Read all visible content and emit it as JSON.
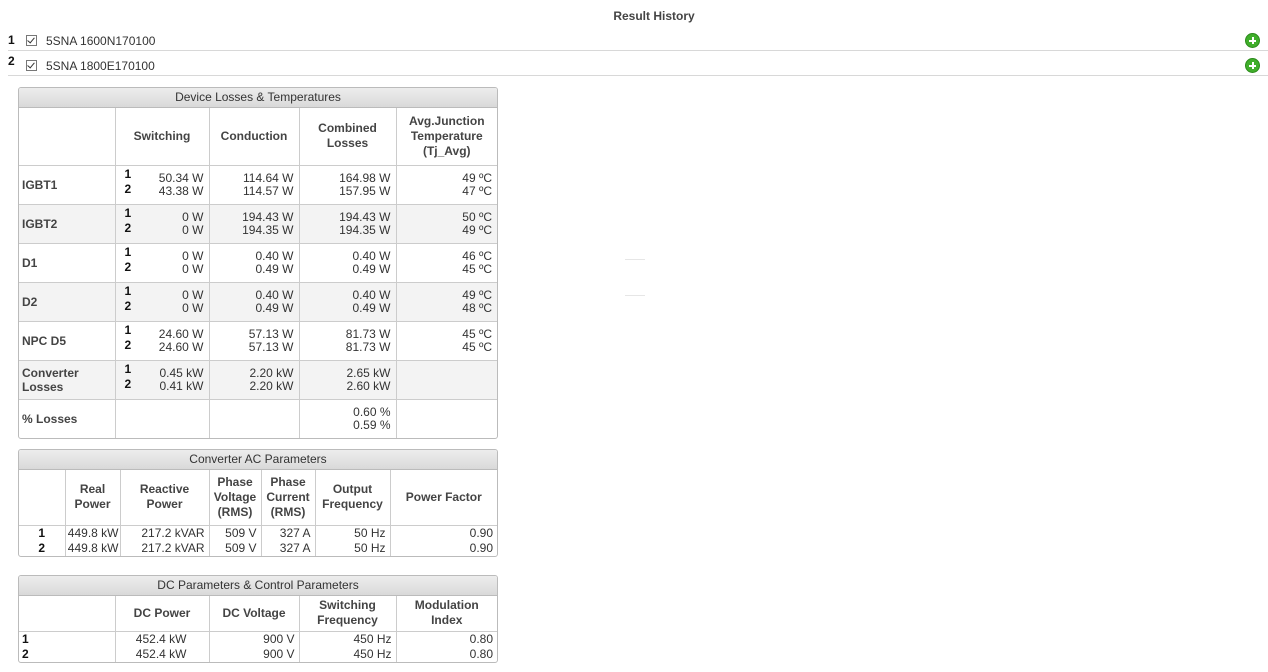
{
  "history": {
    "title": "Result History",
    "items": [
      {
        "index": "1",
        "name": "5SNA 1600N170100"
      },
      {
        "index": "2",
        "name": "5SNA 1800E170100"
      }
    ]
  },
  "losses": {
    "title": "Device Losses & Temperatures",
    "headers": [
      "Switching",
      "Conduction",
      "Combined Losses",
      "Avg.Junction Temperature (Tj_Avg)"
    ],
    "series_labels": [
      "1",
      "2"
    ],
    "rows": [
      {
        "label": "IGBT1",
        "switching": [
          "50.34 W",
          "43.38 W"
        ],
        "conduction": [
          "114.64 W",
          "114.57 W"
        ],
        "combined": [
          "164.98 W",
          "157.95 W"
        ],
        "temp": [
          "49 ºC",
          "47 ºC"
        ]
      },
      {
        "label": "IGBT2",
        "switching": [
          "0 W",
          "0 W"
        ],
        "conduction": [
          "194.43 W",
          "194.35 W"
        ],
        "combined": [
          "194.43 W",
          "194.35 W"
        ],
        "temp": [
          "50 ºC",
          "49 ºC"
        ]
      },
      {
        "label": "D1",
        "switching": [
          "0 W",
          "0 W"
        ],
        "conduction": [
          "0.40 W",
          "0.49 W"
        ],
        "combined": [
          "0.40 W",
          "0.49 W"
        ],
        "temp": [
          "46 ºC",
          "45 ºC"
        ]
      },
      {
        "label": "D2",
        "switching": [
          "0 W",
          "0 W"
        ],
        "conduction": [
          "0.40 W",
          "0.49 W"
        ],
        "combined": [
          "0.40 W",
          "0.49 W"
        ],
        "temp": [
          "49 ºC",
          "48 ºC"
        ]
      },
      {
        "label": "NPC D5",
        "switching": [
          "24.60 W",
          "24.60 W"
        ],
        "conduction": [
          "57.13 W",
          "57.13 W"
        ],
        "combined": [
          "81.73 W",
          "81.73 W"
        ],
        "temp": [
          "45 ºC",
          "45 ºC"
        ]
      }
    ],
    "converter": {
      "label": "Converter Losses",
      "switching": [
        "0.45 kW",
        "0.41 kW"
      ],
      "conduction": [
        "2.20 kW",
        "2.20 kW"
      ],
      "combined": [
        "2.65 kW",
        "2.60 kW"
      ]
    },
    "percent": {
      "label": "% Losses",
      "combined": [
        "0.60 %",
        "0.59 %"
      ]
    }
  },
  "ac": {
    "title": "Converter AC Parameters",
    "headers": [
      "Real Power",
      "Reactive Power",
      "Phase Voltage (RMS)",
      "Phase Current (RMS)",
      "Output Frequency",
      "Power Factor"
    ],
    "rows": [
      {
        "index": "1",
        "values": [
          "449.8 kW",
          "217.2 kVAR",
          "509 V",
          "327 A",
          "50 Hz",
          "0.90"
        ]
      },
      {
        "index": "2",
        "values": [
          "449.8 kW",
          "217.2 kVAR",
          "509 V",
          "327 A",
          "50 Hz",
          "0.90"
        ]
      }
    ]
  },
  "dc": {
    "title": "DC Parameters & Control Parameters",
    "headers": [
      "DC Power",
      "DC Voltage",
      "Switching Frequency",
      "Modulation Index"
    ],
    "rows": [
      {
        "index": "1",
        "values": [
          "452.4 kW",
          "900 V",
          "450 Hz",
          "0.80"
        ]
      },
      {
        "index": "2",
        "values": [
          "452.4 kW",
          "900 V",
          "450 Hz",
          "0.80"
        ]
      }
    ]
  },
  "colors": {
    "add_icon": "#3fae2a",
    "header_bg": "#e2e2e2",
    "shade_row": "#f3f3f3"
  }
}
